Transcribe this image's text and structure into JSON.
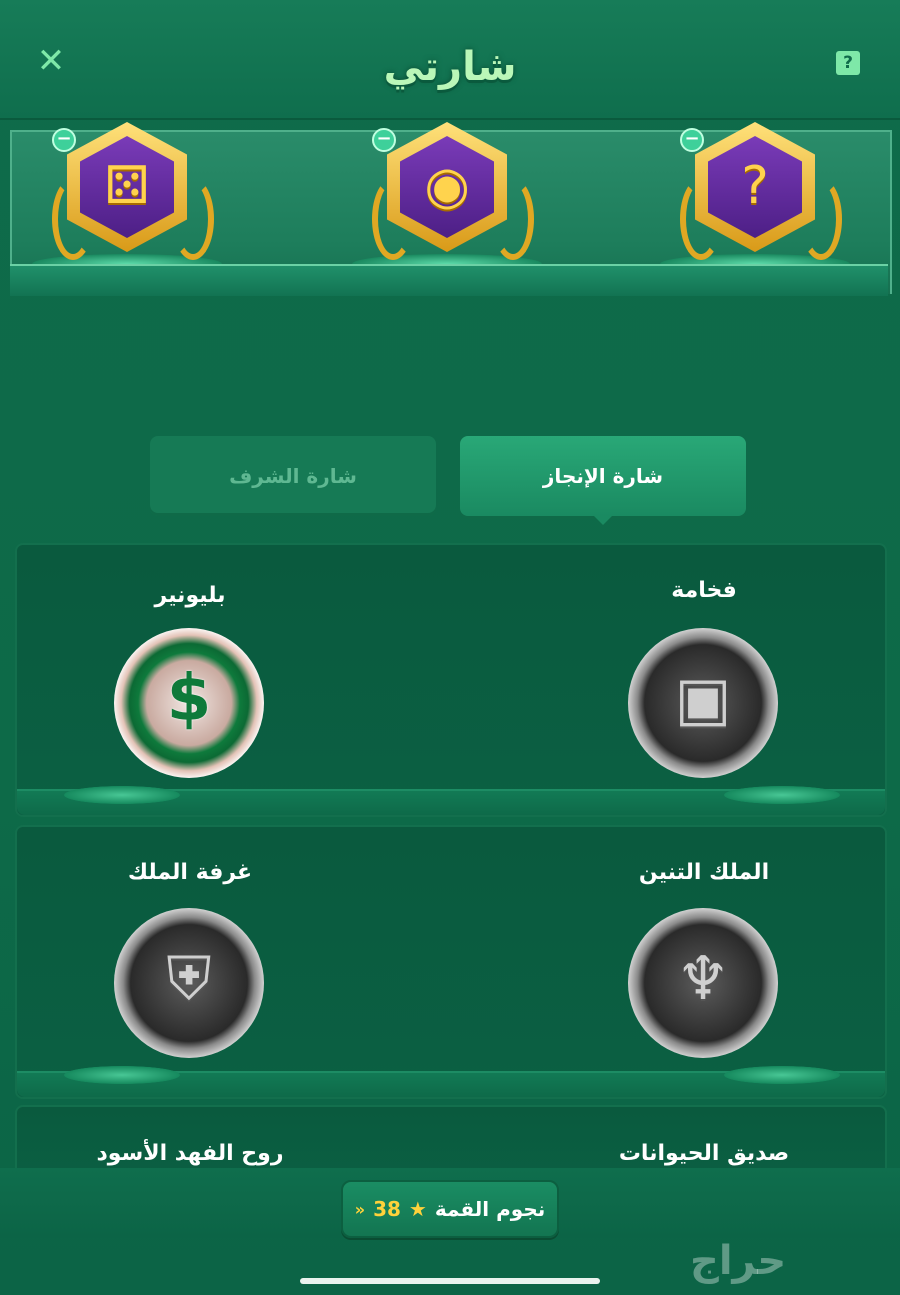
{
  "header": {
    "title": "شارتي",
    "close_icon": "✕",
    "help_icon": "?"
  },
  "showcase": {
    "slots": [
      {
        "icon": "dice-icon",
        "glyph": "⚄"
      },
      {
        "icon": "coins-icon",
        "glyph": "◉"
      },
      {
        "icon": "mystery-chest-icon",
        "glyph": "?"
      }
    ],
    "remove_glyph": "−"
  },
  "tabs": [
    {
      "label": "شارة الإنجاز",
      "active": true
    },
    {
      "label": "شارة الشرف",
      "active": false
    }
  ],
  "badges": {
    "row1": {
      "right": "فخامة",
      "left": "بليونير"
    },
    "row2": {
      "right": "الملك التنين",
      "left": "غرفة الملك"
    },
    "row3": {
      "right": "صديق الحيوانات",
      "left": "روح الفهد الأسود"
    }
  },
  "medal_glyphs": {
    "dollar": "$",
    "chest": "▣",
    "dragon": "♆",
    "shield": "⛨"
  },
  "footer": {
    "stars_label": "نجوم القمة",
    "stars_count": "38",
    "star_glyph": "★",
    "arrow_glyph": "»"
  },
  "watermark": "حراج",
  "colors": {
    "background": "#0f6b4a",
    "title": "#baf7b8",
    "gold": "#ffd23b",
    "purple": "#5a2896"
  }
}
